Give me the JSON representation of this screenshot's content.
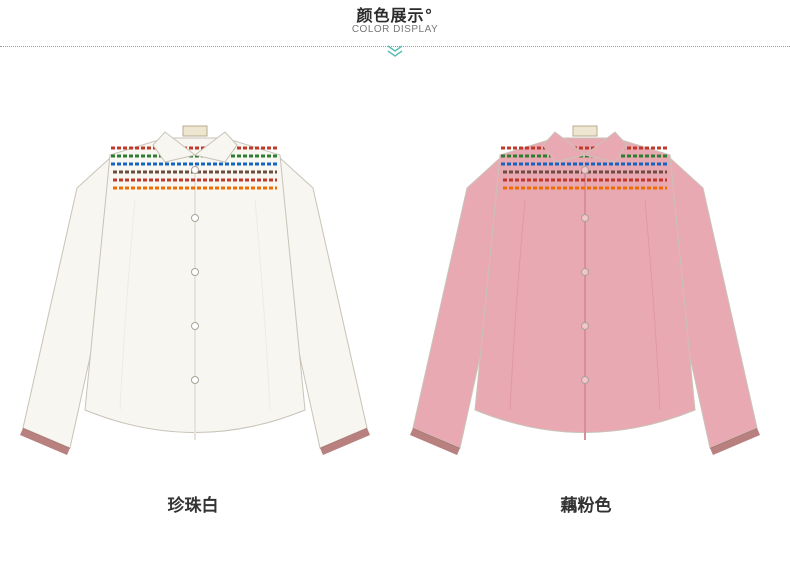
{
  "header": {
    "title": "颜色展示°",
    "subtitle": "COLOR DISPLAY",
    "accent_color": "#5bbdb3"
  },
  "products": [
    {
      "color_name": "珍珠白",
      "shirt_color": "#f7f6f1",
      "shade_color": "#e6e4dc",
      "button_color": "#ffffff"
    },
    {
      "color_name": "藕粉色",
      "shirt_color": "#e9a9b3",
      "shade_color": "#d88f9c",
      "button_color": "#f4c4cb"
    }
  ]
}
